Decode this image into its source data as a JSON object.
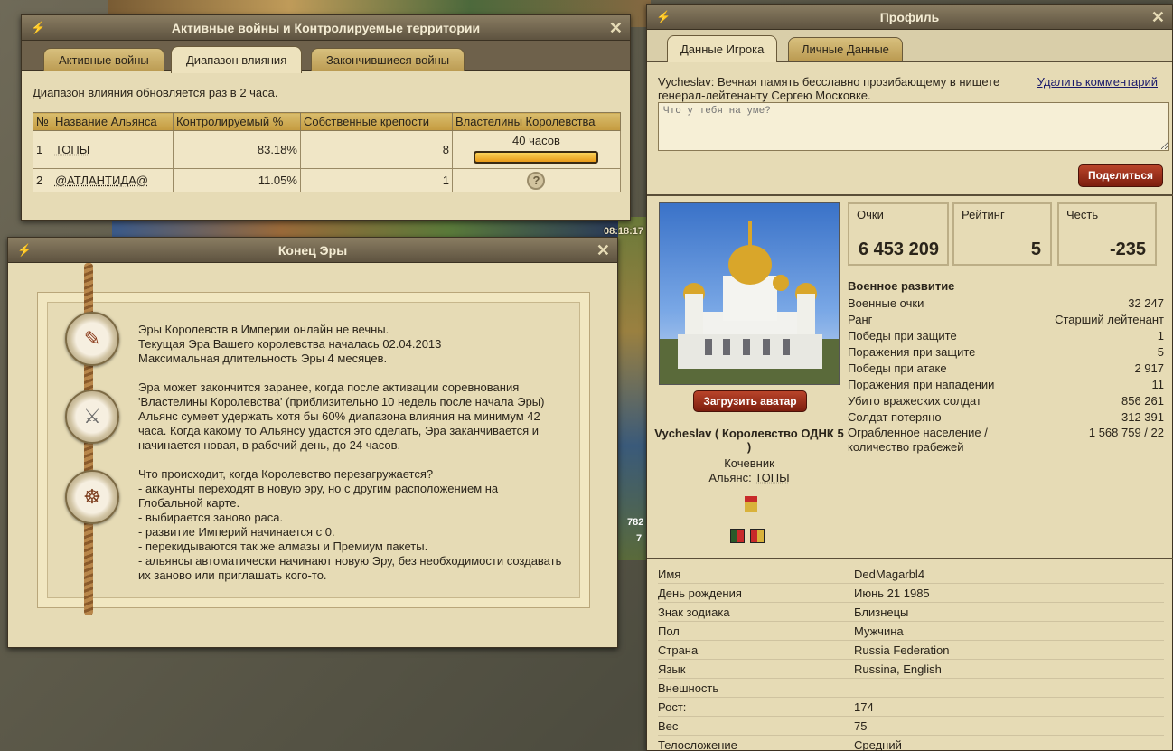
{
  "background": {
    "clock": "08:18:17",
    "num1": "782",
    "num2": "7"
  },
  "war": {
    "title": "Активные войны и Контролируемые территории",
    "tabs": [
      "Активные войны",
      "Диапазон влияния",
      "Закончившиеся войны"
    ],
    "active_tab": 1,
    "info": "Диапазон влияния обновляется раз в 2 часа.",
    "columns": [
      "№",
      "Название Альянса",
      "Контролируемый %",
      "Собственные крепости",
      "Властелины Королевства"
    ],
    "rows": [
      {
        "n": "1",
        "name": "ТОПЫ",
        "pct": "83.18%",
        "forts": "8",
        "lords": "40 часов",
        "progress": 1.0
      },
      {
        "n": "2",
        "name": "@АТЛАНТИДА@",
        "pct": "11.05%",
        "forts": "1",
        "lords": "",
        "icon": "?"
      }
    ]
  },
  "era": {
    "title": "Конец Эры",
    "paragraphs": [
      "Эры Королевств в Империи онлайн не вечны.\nТекущая Эра Вашего королевства началась 02.04.2013\nМаксимальная длительность Эры 4 месяцев.",
      "Эра может закончится заранее, когда после активации соревнования 'Властелины Королевства' (приблизительно 10 недель после начала Эры) Альянс сумеет удержать хотя бы 60% диапазона влияния на минимум 42 часа. Когда какому то Альянсу удастся это сделать, Эра заканчивается и начинается новая, в рабочий день, до 24 часов.",
      "Что происходит, когда Королевство перезагружается?\n- аккаунты переходят в новую эру, но с другим расположением на Глобальной карте.\n- выбирается заново раса.\n- развитие Империй начинается с 0.\n- перекидываются так же алмазы и Премиум пакеты.\n- альянсы автоматически начинают новую Эру, без необходимости создавать их заново или приглашать кого-то."
    ]
  },
  "profile": {
    "title": "Профиль",
    "tabs": [
      "Данные Игрока",
      "Личные Данные"
    ],
    "comment": "Vycheslav: Вечная память бесславно прозибающему в нищете генерал-лейтенанту Сергею Московке.",
    "delete_label": "Удалить комментарий",
    "textarea_placeholder": "Что у тебя на уме?",
    "share_label": "Поделиться",
    "upload_label": "Загрузить аватар",
    "player_name": "Vycheslav ( Королевство ОДНК 5 )",
    "race": "Кочевник",
    "alliance_label": "Альянс:",
    "alliance": "ТОПЫ",
    "stats": [
      {
        "label": "Очки",
        "value": "6 453 209"
      },
      {
        "label": "Рейтинг",
        "value": "5"
      },
      {
        "label": "Честь",
        "value": "-235"
      }
    ],
    "military_title": "Военное развитие",
    "military": [
      {
        "k": "Военные очки",
        "v": "32 247"
      },
      {
        "k": "Ранг",
        "v": "Старший лейтенант"
      },
      {
        "k": "Победы при защите",
        "v": "1"
      },
      {
        "k": "Поражения при защите",
        "v": "5"
      },
      {
        "k": "Победы при атаке",
        "v": "2 917"
      },
      {
        "k": "Поражения при нападении",
        "v": "11"
      },
      {
        "k": "Убито вражеских солдат",
        "v": "856 261"
      },
      {
        "k": "Солдат потеряно",
        "v": "312 391"
      },
      {
        "k": "Ограбленное население / количество грабежей",
        "v": "1 568 759 / 22"
      }
    ],
    "personal": [
      {
        "k": "Имя",
        "v": "DedMagarbl4"
      },
      {
        "k": "День рождения",
        "v": "Июнь 21 1985"
      },
      {
        "k": "Знак зодиака",
        "v": "Близнецы"
      },
      {
        "k": "Пол",
        "v": "Мужчина"
      },
      {
        "k": "Страна",
        "v": "Russia Federation"
      },
      {
        "k": "Язык",
        "v": "Russina, English"
      },
      {
        "k": "Внешность",
        "v": ""
      },
      {
        "k": "Рост:",
        "v": "174"
      },
      {
        "k": "Вес",
        "v": "75"
      },
      {
        "k": "Телосложение",
        "v": "Средний"
      }
    ]
  }
}
